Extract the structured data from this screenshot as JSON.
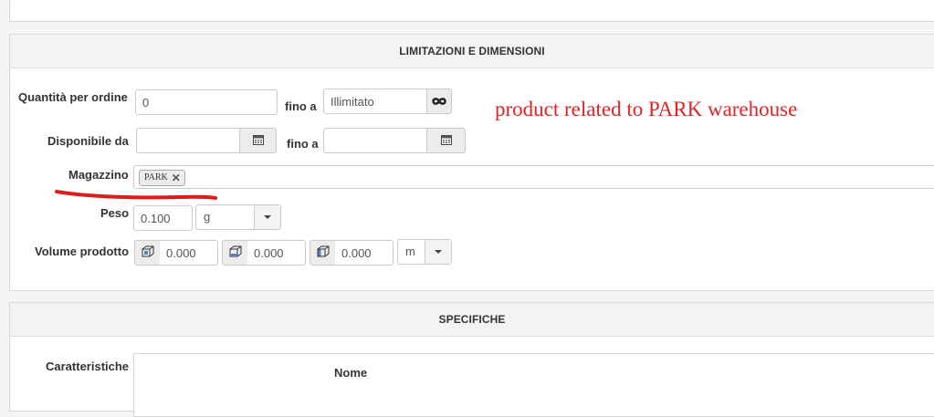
{
  "limits": {
    "title": "LIMITAZIONI E DIMENSIONI",
    "qty_label": "Quantità per ordine",
    "qty_min_value": "0",
    "fino_a": "fino a",
    "qty_max_value": "Illimitato",
    "avail_label": "Disponibile da",
    "avail_from_value": "",
    "avail_to_value": "",
    "warehouse_label": "Magazzino",
    "warehouse_tags": [
      "PARK"
    ],
    "weight_label": "Peso",
    "weight_value": "0.100",
    "weight_unit": "g",
    "volume_label": "Volume prodotto",
    "volume_values": [
      "0.000",
      "0.000",
      "0.000"
    ],
    "volume_unit": "m"
  },
  "annotation": {
    "text": "product related to PARK warehouse",
    "color": "#e32222"
  },
  "specs": {
    "title": "SPECIFICHE",
    "features_label": "Caratteristiche",
    "col_name": "Nome"
  },
  "icons": {
    "infinity": "infinity-icon",
    "calendar": "calendar-icon",
    "box": "box-dimension-icon",
    "remove": "close-icon",
    "caret": "chevron-down-icon"
  }
}
